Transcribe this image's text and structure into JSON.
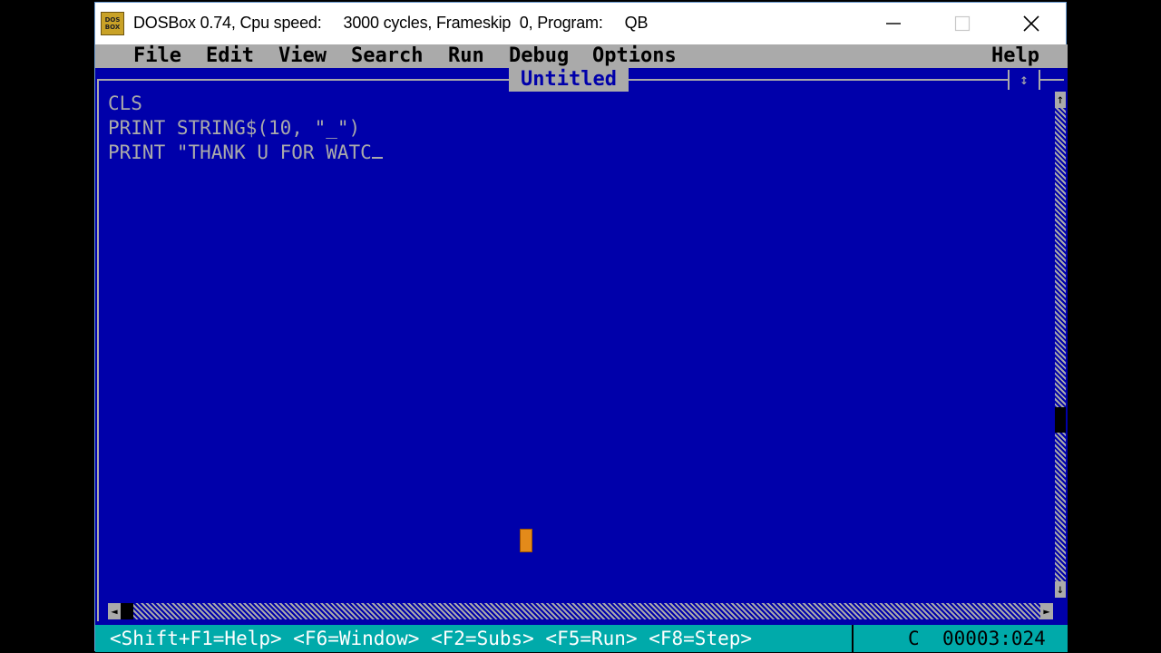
{
  "window": {
    "title": "DOSBox 0.74, Cpu speed:     3000 cycles, Frameskip  0, Program:     QB",
    "icon_label": "DOS BOX",
    "buttons": [
      "minimize-icon",
      "maximize-icon",
      "close-icon"
    ]
  },
  "menu": {
    "items": [
      "File",
      "Edit",
      "View",
      "Search",
      "Run",
      "Debug",
      "Options"
    ],
    "help": "Help"
  },
  "editor": {
    "title": "Untitled",
    "lines": [
      "CLS",
      "PRINT STRING$(10, \"_\")",
      "PRINT \"THANK U FOR WATC"
    ]
  },
  "statusbar": {
    "keys": "<Shift+F1=Help> <F6=Window> <F2=Subs> <F5=Run> <F8=Step>",
    "mode": "C",
    "position": "00003:024"
  },
  "colors": {
    "background": "#0000aa",
    "text": "#aaaaaa",
    "menubar": "#aaaaaa",
    "statusbar": "#00aaaa",
    "mouse_cursor": "#e38a1a"
  }
}
